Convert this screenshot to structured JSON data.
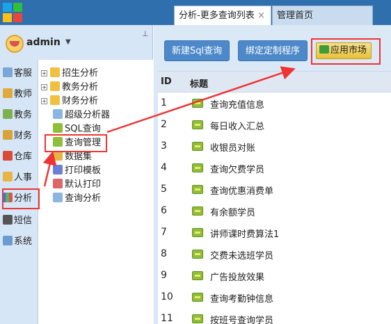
{
  "window": {
    "tabs": [
      {
        "label": "分析-更多查询列表",
        "close": "×"
      },
      {
        "label": "管理首页"
      }
    ]
  },
  "user": {
    "name": "admin",
    "caret": "▼",
    "pin": "⊥"
  },
  "sidenav": [
    {
      "label": "客服",
      "icon": "headset-icon"
    },
    {
      "label": "教师",
      "icon": "teacher-icon"
    },
    {
      "label": "教务",
      "icon": "academic-icon"
    },
    {
      "label": "财务",
      "icon": "finance-icon"
    },
    {
      "label": "仓库",
      "icon": "warehouse-icon"
    },
    {
      "label": "人事",
      "icon": "hr-icon"
    },
    {
      "label": "分析",
      "icon": "chart-icon"
    },
    {
      "label": "短信",
      "icon": "sms-icon"
    },
    {
      "label": "系统",
      "icon": "system-icon"
    }
  ],
  "tree": [
    {
      "label": "招生分析",
      "expand": "+",
      "icon": "search-icon"
    },
    {
      "label": "教务分析",
      "expand": "+",
      "icon": "search-icon"
    },
    {
      "label": "财务分析",
      "expand": "+",
      "icon": "search-icon"
    },
    {
      "label": "超级分析器",
      "icon": "search-icon"
    },
    {
      "label": "SQL查询",
      "icon": "sql-icon"
    },
    {
      "label": "查询管理",
      "icon": "query-manage-icon"
    },
    {
      "label": "数据集",
      "icon": "xml-icon"
    },
    {
      "label": "打印模板",
      "icon": "print-template-icon"
    },
    {
      "label": "默认打印",
      "icon": "printer-icon"
    },
    {
      "label": "查询分析",
      "icon": "search-icon"
    }
  ],
  "toolbar": {
    "new_sql": "新建Sql查询",
    "bind_program": "绑定定制程序",
    "app_market": "应用市场"
  },
  "grid": {
    "headers": {
      "id": "ID",
      "title": "标题"
    },
    "rows": [
      {
        "id": "1",
        "title": "查询充值信息"
      },
      {
        "id": "2",
        "title": "每日收入汇总"
      },
      {
        "id": "3",
        "title": "收银员对账"
      },
      {
        "id": "4",
        "title": "查询欠费学员"
      },
      {
        "id": "5",
        "title": "查询优惠消费单"
      },
      {
        "id": "6",
        "title": "有余额学员"
      },
      {
        "id": "7",
        "title": "讲师课时费算法1"
      },
      {
        "id": "8",
        "title": "交费未选班学员"
      },
      {
        "id": "9",
        "title": "广告投放效果"
      },
      {
        "id": "10",
        "title": "查询考勤钟信息"
      },
      {
        "id": "11",
        "title": "按班号查询学员"
      }
    ]
  },
  "colors": {
    "topbar": "#2f6fae",
    "button": "#4d89c9",
    "highlight": "#e33",
    "panel": "#d6e6f6"
  }
}
